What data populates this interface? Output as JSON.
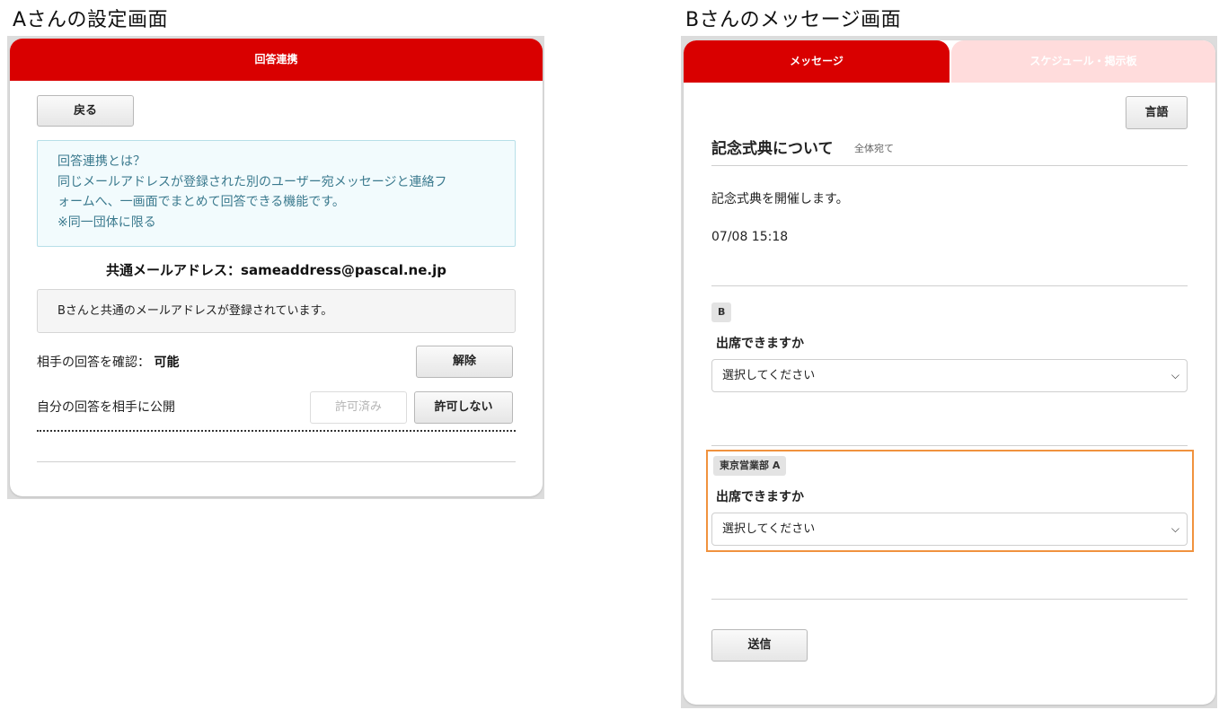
{
  "captions": {
    "left": "Aさんの設定画面",
    "right": "Bさんのメッセージ画面"
  },
  "settings": {
    "header_title": "回答連携",
    "back_button": "戻る",
    "info_lines": [
      "回答連携とは？",
      "同じメールアドレスが登録された別のユーザー宛メッセージと連絡フ",
      "ォームへ、一画面でまとめて回答できる機能です。",
      "※同一団体に限る"
    ],
    "common_email_label": "共通メールアドレス：",
    "common_email": "sameaddress@pascal.ne.jp",
    "notice": "Bさんと共通のメールアドレスが登録されています。",
    "confirm_label": "相手の回答を確認：",
    "confirm_value": "可能",
    "unlink_button": "解除",
    "publish_label": "自分の回答を相手に公開",
    "permitted_button": "許可済み",
    "deny_button": "許可しない"
  },
  "message": {
    "tabs": [
      {
        "label": "メッセージ",
        "active": true
      },
      {
        "label": "スケジュール・掲示板",
        "active": false
      }
    ],
    "language_button": "言語",
    "title": "記念式典について",
    "audience": "全体宛て",
    "body": "記念式典を開催します。",
    "date": "07/08 15:18",
    "forms": [
      {
        "recipient": "B",
        "question": "出席できますか",
        "select_value": "選択してください"
      },
      {
        "recipient": "東京営業部 A",
        "question": "出席できますか",
        "select_value": "選択してください"
      }
    ],
    "send_button": "送信"
  },
  "colors": {
    "brand_red": "#d90000",
    "inactive_tab": "#ffdcdc",
    "info_bg": "#f2fbfd",
    "info_text": "#3b7a8e",
    "highlight": "#f0923e"
  }
}
